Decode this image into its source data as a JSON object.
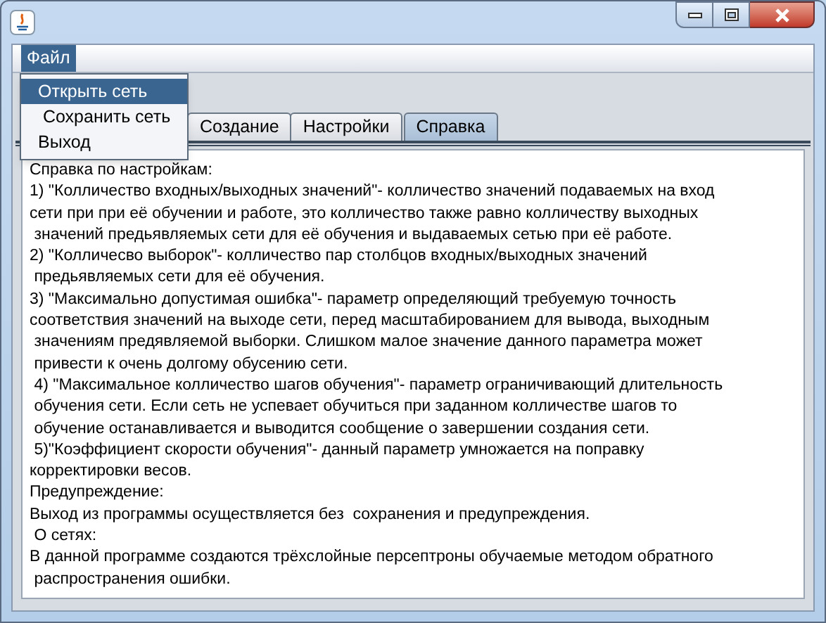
{
  "menu_bar": [
    {
      "label": "Файл",
      "selected": true
    }
  ],
  "file_menu": [
    {
      "label": "Открыть сеть",
      "selected": true
    },
    {
      "label": " Сохранить сеть",
      "selected": false
    },
    {
      "label": "Выход",
      "selected": false
    }
  ],
  "tabs": [
    {
      "label": "Создание",
      "selected": false
    },
    {
      "label": "Настройки",
      "selected": false
    },
    {
      "label": "Справка",
      "selected": true
    }
  ],
  "help_text": [
    "Справка по настройкам:",
    "1) \"Колличество входных/выходных значений\"- колличество значений подаваемых на вход",
    "сети при при её обучении и работе, это колличество также равно колличеству выходных",
    " значений предьявляемых сети для её обучения и выдаваемых сетью при её работе.",
    "2) \"Колличесво выборок\"- колличество пар столбцов входных/выходных значений",
    " предьявляемых сети для её обучения.",
    "3) \"Максимально допустимая ошибка\"- параметр определяющий требуемую точность",
    "соответствия значений на выходе сети, перед масштабированием для вывода, выходным",
    " значениям предявляемой выборки. Слишком малое значение данного параметра может",
    " привести к очень долгому обусению сети.",
    " 4) \"Максимальное колличество шагов обучения\"- параметр ограничивающий длительность",
    " обучения сети. Если сеть не успевает обучиться при заданном колличестве шагов то",
    " обучение останавливается и выводится сообщение о завершении создания сети.",
    " 5)\"Коэффициент скорости обучения\"- данный параметр умножается на поправку",
    "корректировки весов.",
    "Предупреждение:",
    "Выход из программы осуществляется без  сохранения и предупреждения.",
    " О сетях:",
    "В данной программе создаются трёхслойные персептроны обучаемые методом обратного",
    " распространения ошибки."
  ]
}
